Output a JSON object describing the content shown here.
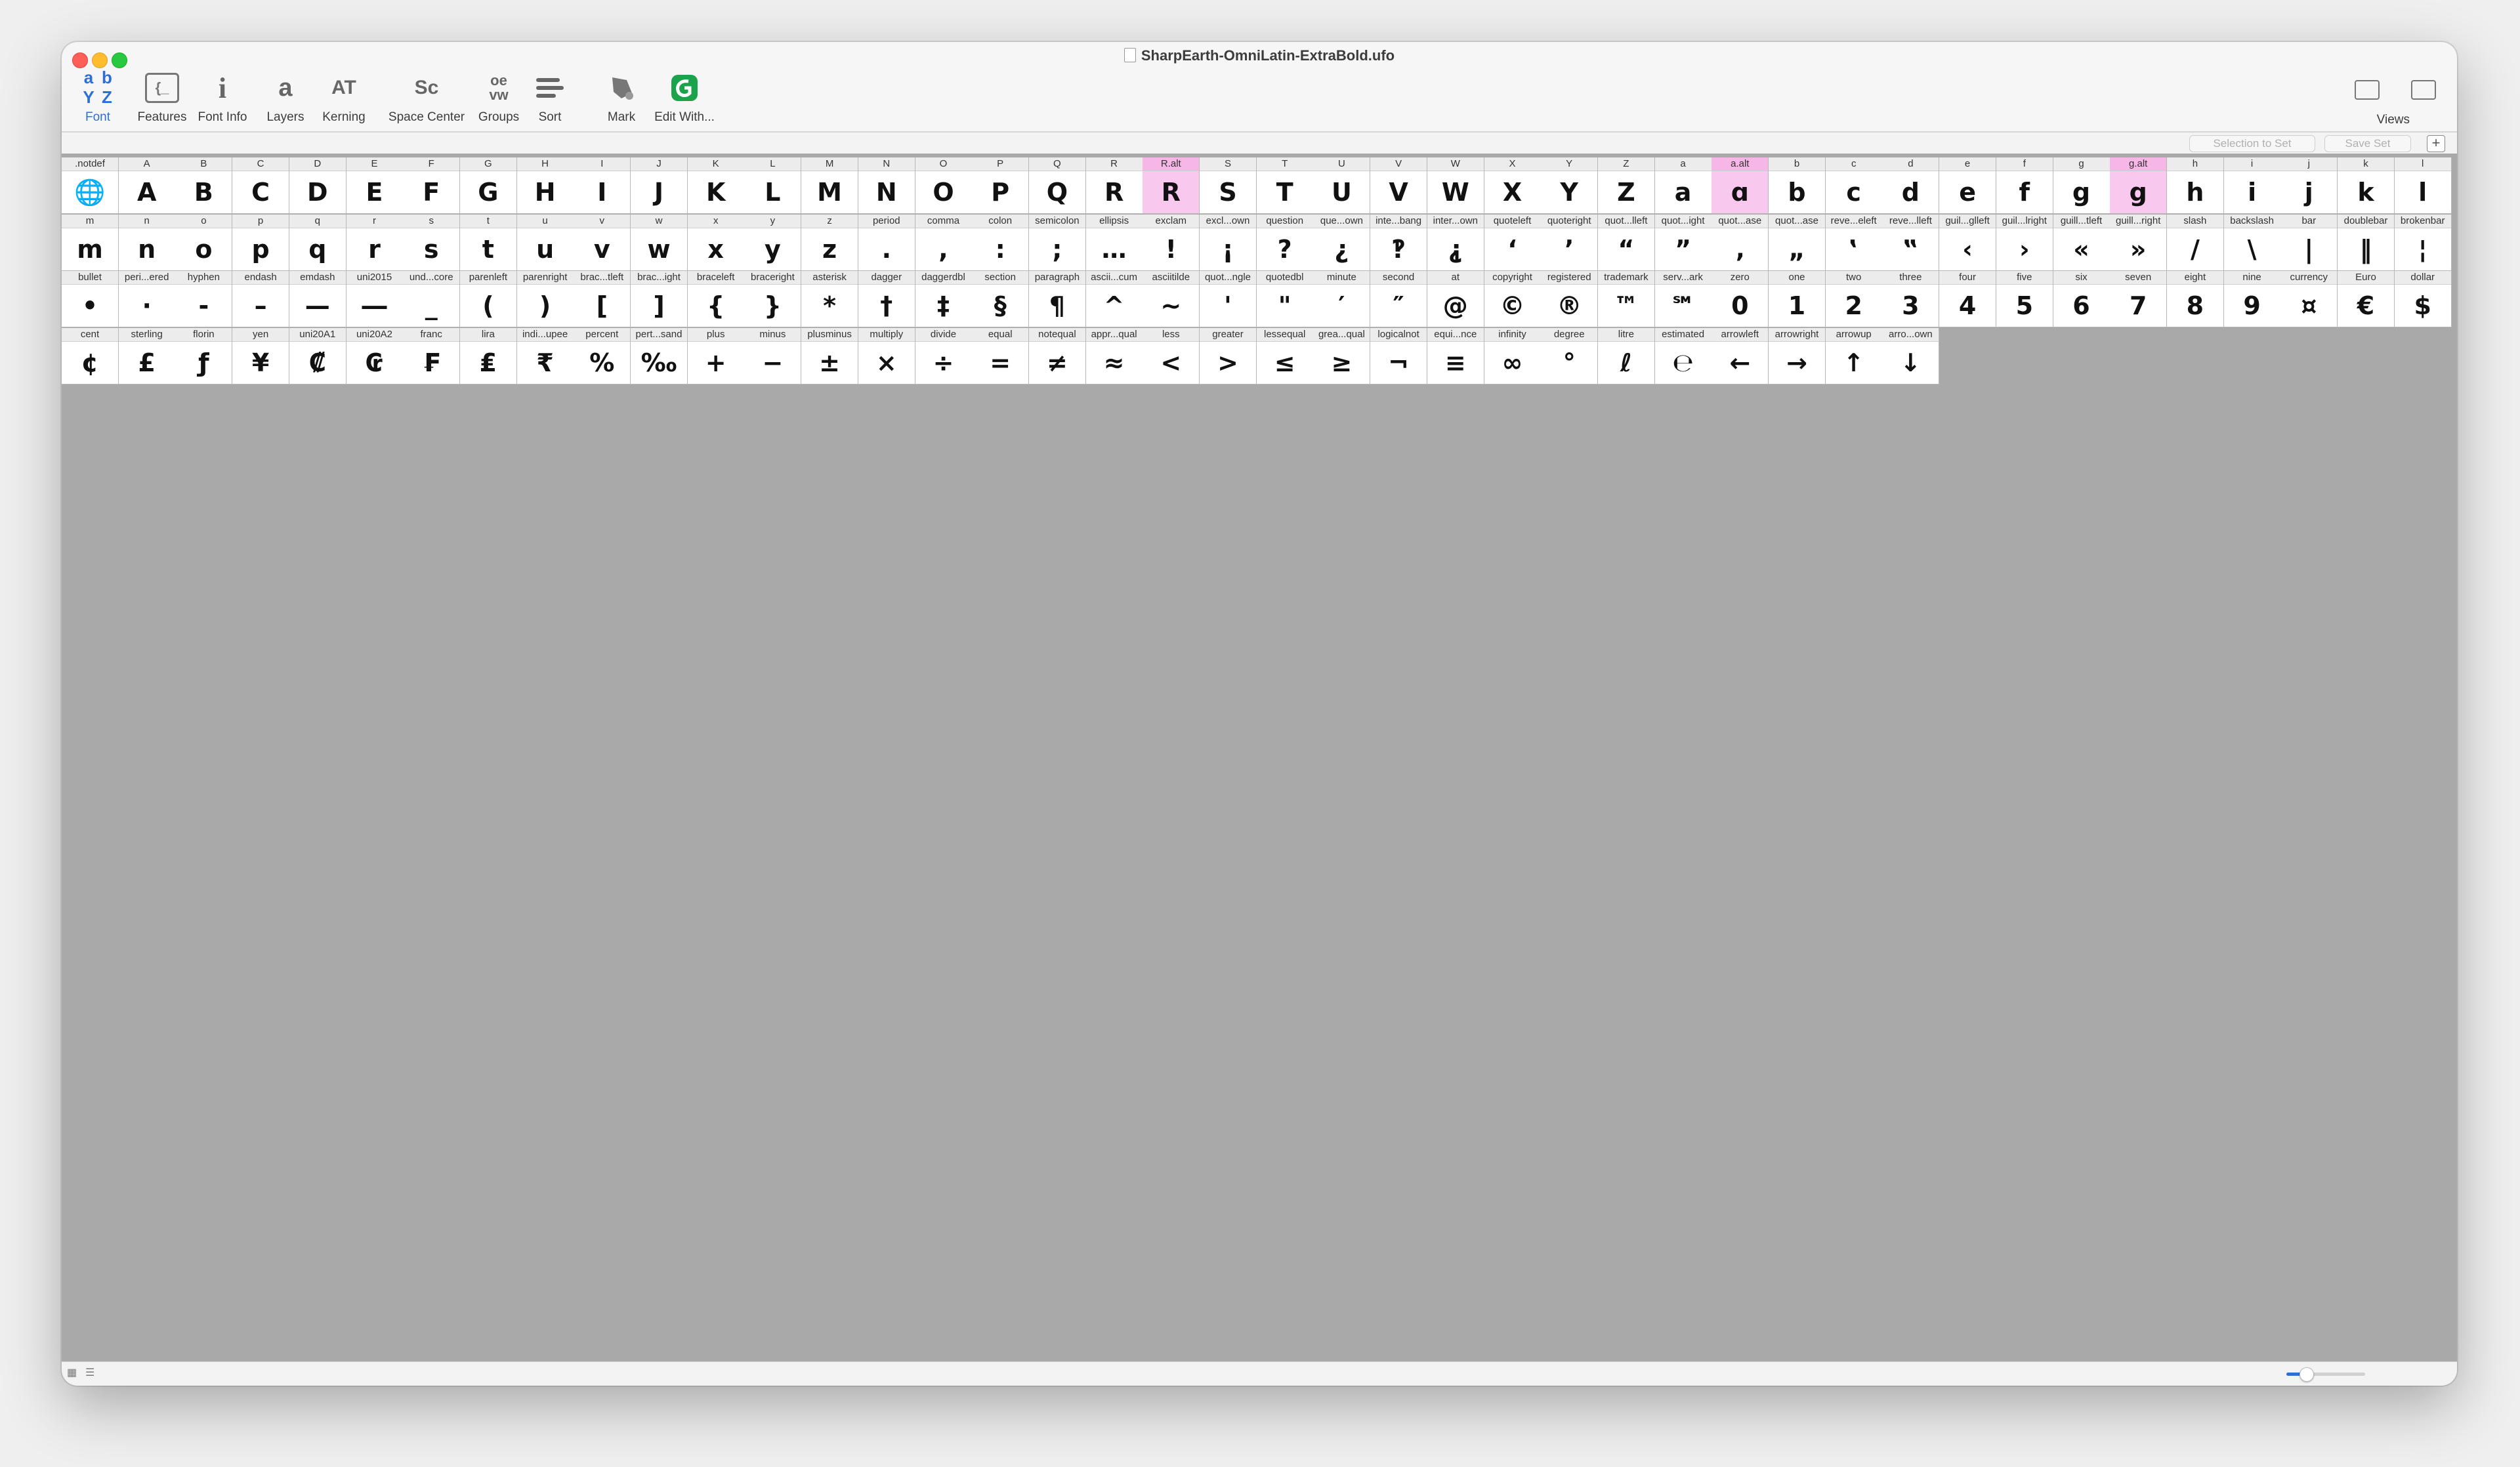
{
  "window": {
    "title": "SharpEarth-OmniLatin-ExtraBold.ufo"
  },
  "toolbar": {
    "items": [
      {
        "id": "font",
        "label": "Font",
        "icon": "font-glyph-icon"
      },
      {
        "id": "features",
        "label": "Features",
        "icon": "features-icon"
      },
      {
        "id": "font-info",
        "label": "Font Info",
        "icon": "info-icon"
      },
      {
        "id": "layers",
        "label": "Layers",
        "icon": "layers-icon"
      },
      {
        "id": "kerning",
        "label": "Kerning",
        "icon": "kerning-icon"
      },
      {
        "id": "space-center",
        "label": "Space Center",
        "icon": "space-center-icon"
      },
      {
        "id": "groups",
        "label": "Groups",
        "icon": "groups-icon"
      },
      {
        "id": "sort",
        "label": "Sort",
        "icon": "sort-icon"
      },
      {
        "id": "mark",
        "label": "Mark",
        "icon": "mark-icon"
      },
      {
        "id": "edit-with",
        "label": "Edit With...",
        "icon": "glyphs-app-icon"
      }
    ],
    "font_icon_letters": [
      "a",
      "b",
      "Y",
      "Z"
    ],
    "features_icon_text": "{_",
    "font_info_icon_text": "i",
    "layers_icon_text": "a",
    "kerning_icon_text": "AT",
    "space_center_icon_text": "Sc",
    "groups_icon_text": "oe vw",
    "views_label": "Views",
    "selection_to_set": "Selection to Set",
    "save_set": "Save Set",
    "plus": "+"
  },
  "colors": {
    "accent": "#2d6fd6",
    "highlight_mark": "#f9c8ee",
    "canvas": "#a9a9a9"
  },
  "glyph_rows": [
    [
      {
        "name": ".notdef",
        "char": "🌐"
      },
      {
        "name": "A",
        "char": "A"
      },
      {
        "name": "B",
        "char": "B"
      },
      {
        "name": "C",
        "char": "C"
      },
      {
        "name": "D",
        "char": "D"
      },
      {
        "name": "E",
        "char": "E"
      },
      {
        "name": "F",
        "char": "F"
      },
      {
        "name": "G",
        "char": "G"
      },
      {
        "name": "H",
        "char": "H"
      },
      {
        "name": "I",
        "char": "I"
      },
      {
        "name": "J",
        "char": "J"
      },
      {
        "name": "K",
        "char": "K"
      },
      {
        "name": "L",
        "char": "L"
      },
      {
        "name": "M",
        "char": "M"
      },
      {
        "name": "N",
        "char": "N"
      },
      {
        "name": "O",
        "char": "O"
      },
      {
        "name": "P",
        "char": "P"
      },
      {
        "name": "Q",
        "char": "Q"
      },
      {
        "name": "R",
        "char": "R"
      },
      {
        "name": "R.alt",
        "char": "R",
        "marked": true
      },
      {
        "name": "S",
        "char": "S"
      },
      {
        "name": "T",
        "char": "T"
      },
      {
        "name": "U",
        "char": "U"
      },
      {
        "name": "V",
        "char": "V"
      },
      {
        "name": "W",
        "char": "W"
      },
      {
        "name": "X",
        "char": "X"
      },
      {
        "name": "Y",
        "char": "Y"
      },
      {
        "name": "Z",
        "char": "Z"
      },
      {
        "name": "a",
        "char": "a"
      },
      {
        "name": "a.alt",
        "char": "ɑ",
        "marked": true
      },
      {
        "name": "b",
        "char": "b"
      },
      {
        "name": "c",
        "char": "c"
      },
      {
        "name": "d",
        "char": "d"
      },
      {
        "name": "e",
        "char": "e"
      },
      {
        "name": "f",
        "char": "f"
      },
      {
        "name": "g",
        "char": "g"
      },
      {
        "name": "g.alt",
        "char": "g",
        "marked": true
      },
      {
        "name": "h",
        "char": "h"
      },
      {
        "name": "i",
        "char": "i"
      },
      {
        "name": "j",
        "char": "j"
      },
      {
        "name": "k",
        "char": "k"
      },
      {
        "name": "l",
        "char": "l"
      }
    ],
    [
      {
        "name": "m",
        "char": "m"
      },
      {
        "name": "n",
        "char": "n"
      },
      {
        "name": "o",
        "char": "o"
      },
      {
        "name": "p",
        "char": "p"
      },
      {
        "name": "q",
        "char": "q"
      },
      {
        "name": "r",
        "char": "r"
      },
      {
        "name": "s",
        "char": "s"
      },
      {
        "name": "t",
        "char": "t"
      },
      {
        "name": "u",
        "char": "u"
      },
      {
        "name": "v",
        "char": "v"
      },
      {
        "name": "w",
        "char": "w"
      },
      {
        "name": "x",
        "char": "x"
      },
      {
        "name": "y",
        "char": "y"
      },
      {
        "name": "z",
        "char": "z"
      },
      {
        "name": "period",
        "char": "."
      },
      {
        "name": "comma",
        "char": ","
      },
      {
        "name": "colon",
        "char": ":"
      },
      {
        "name": "semicolon",
        "char": ";"
      },
      {
        "name": "ellipsis",
        "char": "…"
      },
      {
        "name": "exclam",
        "char": "!"
      },
      {
        "name": "excl...own",
        "char": "¡"
      },
      {
        "name": "question",
        "char": "?"
      },
      {
        "name": "que...own",
        "char": "¿"
      },
      {
        "name": "inte...bang",
        "char": "‽"
      },
      {
        "name": "inter...own",
        "char": "⸘"
      },
      {
        "name": "quoteleft",
        "char": "‘"
      },
      {
        "name": "quoteright",
        "char": "’"
      },
      {
        "name": "quot...lleft",
        "char": "“"
      },
      {
        "name": "quot...ight",
        "char": "”"
      },
      {
        "name": "quot...ase",
        "char": "‚"
      },
      {
        "name": "quot...ase",
        "char": "„"
      },
      {
        "name": "reve...eleft",
        "char": "‛"
      },
      {
        "name": "reve...lleft",
        "char": "‟"
      },
      {
        "name": "guil...glleft",
        "char": "‹"
      },
      {
        "name": "guil...lright",
        "char": "›"
      },
      {
        "name": "guill...tleft",
        "char": "«"
      },
      {
        "name": "guill...right",
        "char": "»"
      },
      {
        "name": "slash",
        "char": "/"
      },
      {
        "name": "backslash",
        "char": "\\"
      },
      {
        "name": "bar",
        "char": "|"
      },
      {
        "name": "doublebar",
        "char": "‖"
      },
      {
        "name": "brokenbar",
        "char": "¦"
      }
    ],
    [
      {
        "name": "bullet",
        "char": "•"
      },
      {
        "name": "peri...ered",
        "char": "·"
      },
      {
        "name": "hyphen",
        "char": "-"
      },
      {
        "name": "endash",
        "char": "–"
      },
      {
        "name": "emdash",
        "char": "—"
      },
      {
        "name": "uni2015",
        "char": "―"
      },
      {
        "name": "und...core",
        "char": "_"
      },
      {
        "name": "parenleft",
        "char": "("
      },
      {
        "name": "parenright",
        "char": ")"
      },
      {
        "name": "brac...tleft",
        "char": "["
      },
      {
        "name": "brac...ight",
        "char": "]"
      },
      {
        "name": "braceleft",
        "char": "{"
      },
      {
        "name": "braceright",
        "char": "}"
      },
      {
        "name": "asterisk",
        "char": "*"
      },
      {
        "name": "dagger",
        "char": "†"
      },
      {
        "name": "daggerdbl",
        "char": "‡"
      },
      {
        "name": "section",
        "char": "§"
      },
      {
        "name": "paragraph",
        "char": "¶"
      },
      {
        "name": "ascii...cum",
        "char": "^"
      },
      {
        "name": "asciitilde",
        "char": "~"
      },
      {
        "name": "quot...ngle",
        "char": "'"
      },
      {
        "name": "quotedbl",
        "char": "\""
      },
      {
        "name": "minute",
        "char": "′"
      },
      {
        "name": "second",
        "char": "″"
      },
      {
        "name": "at",
        "char": "@"
      },
      {
        "name": "copyright",
        "char": "©"
      },
      {
        "name": "registered",
        "char": "®"
      },
      {
        "name": "trademark",
        "char": "™"
      },
      {
        "name": "serv...ark",
        "char": "℠"
      },
      {
        "name": "zero",
        "char": "0"
      },
      {
        "name": "one",
        "char": "1"
      },
      {
        "name": "two",
        "char": "2"
      },
      {
        "name": "three",
        "char": "3"
      },
      {
        "name": "four",
        "char": "4"
      },
      {
        "name": "five",
        "char": "5"
      },
      {
        "name": "six",
        "char": "6"
      },
      {
        "name": "seven",
        "char": "7"
      },
      {
        "name": "eight",
        "char": "8"
      },
      {
        "name": "nine",
        "char": "9"
      },
      {
        "name": "currency",
        "char": "¤"
      },
      {
        "name": "Euro",
        "char": "€"
      },
      {
        "name": "dollar",
        "char": "$"
      }
    ],
    [
      {
        "name": "cent",
        "char": "¢"
      },
      {
        "name": "sterling",
        "char": "£"
      },
      {
        "name": "florin",
        "char": "ƒ"
      },
      {
        "name": "yen",
        "char": "¥"
      },
      {
        "name": "uni20A1",
        "char": "₡"
      },
      {
        "name": "uni20A2",
        "char": "₢"
      },
      {
        "name": "franc",
        "char": "₣"
      },
      {
        "name": "lira",
        "char": "₤"
      },
      {
        "name": "indi...upee",
        "char": "₹"
      },
      {
        "name": "percent",
        "char": "%"
      },
      {
        "name": "pert...sand",
        "char": "‰"
      },
      {
        "name": "plus",
        "char": "+"
      },
      {
        "name": "minus",
        "char": "−"
      },
      {
        "name": "plusminus",
        "char": "±"
      },
      {
        "name": "multiply",
        "char": "×"
      },
      {
        "name": "divide",
        "char": "÷"
      },
      {
        "name": "equal",
        "char": "="
      },
      {
        "name": "notequal",
        "char": "≠"
      },
      {
        "name": "appr...qual",
        "char": "≈"
      },
      {
        "name": "less",
        "char": "<"
      },
      {
        "name": "greater",
        "char": ">"
      },
      {
        "name": "lessequal",
        "char": "≤"
      },
      {
        "name": "grea...qual",
        "char": "≥"
      },
      {
        "name": "logicalnot",
        "char": "¬"
      },
      {
        "name": "equi...nce",
        "char": "≡"
      },
      {
        "name": "infinity",
        "char": "∞"
      },
      {
        "name": "degree",
        "char": "°"
      },
      {
        "name": "litre",
        "char": "ℓ"
      },
      {
        "name": "estimated",
        "char": "℮"
      },
      {
        "name": "arrowleft",
        "char": "←"
      },
      {
        "name": "arrowright",
        "char": "→"
      },
      {
        "name": "arrowup",
        "char": "↑"
      },
      {
        "name": "arro...own",
        "char": "↓"
      }
    ]
  ],
  "bottombar": {
    "zoom_fraction": 0.25
  }
}
